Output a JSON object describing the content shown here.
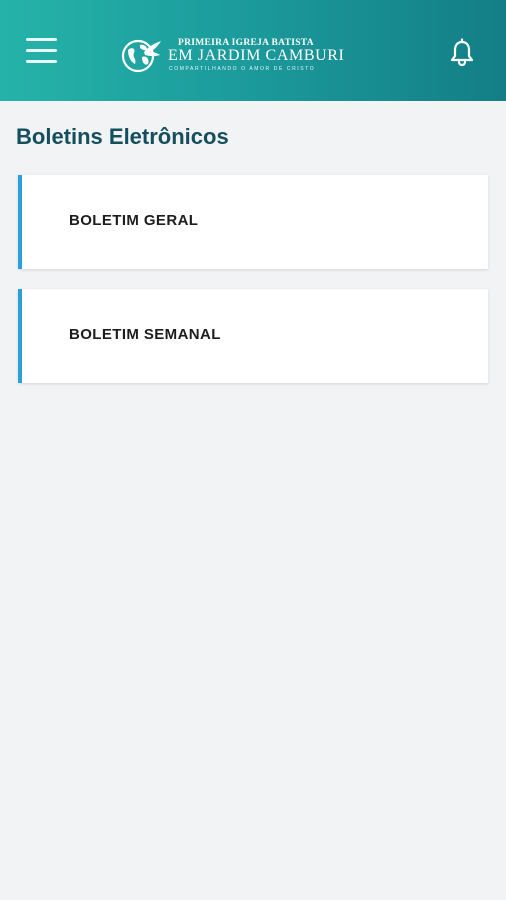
{
  "header": {
    "logo": {
      "line1": "PRIMEIRA IGREJA BATISTA",
      "line2": "EM JARDIM CAMBURI",
      "tagline": "COMPARTILHANDO O AMOR DE CRISTO"
    },
    "menu_icon": "hamburger-menu-icon",
    "notification_icon": "bell-icon",
    "colors": {
      "gradient_start": "#25b3a9",
      "gradient_end": "#137e86"
    }
  },
  "page": {
    "title": "Boletins Eletrônicos"
  },
  "bulletins": [
    {
      "label": "BOLETIM GERAL"
    },
    {
      "label": "BOLETIM SEMANAL"
    }
  ],
  "colors": {
    "accent": "#2a9fde",
    "title": "#154f5e",
    "background": "#f1f3f5"
  }
}
